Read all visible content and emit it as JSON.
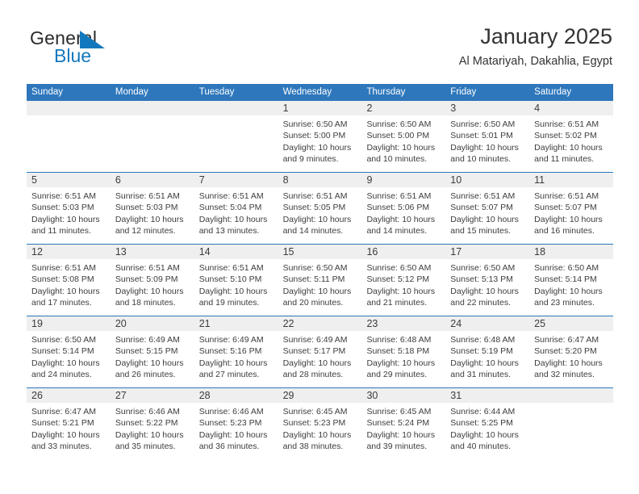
{
  "brand": {
    "name_part1": "General",
    "name_part2": "Blue",
    "accent_color": "#1278be",
    "flag_icon": "triangle-flag-icon"
  },
  "header": {
    "title": "January 2025",
    "subtitle": "Al Matariyah, Dakahlia, Egypt"
  },
  "calendar": {
    "header_color": "#2e77bc",
    "daynum_band_color": "#efefef",
    "weekdays": [
      "Sunday",
      "Monday",
      "Tuesday",
      "Wednesday",
      "Thursday",
      "Friday",
      "Saturday"
    ],
    "weeks": [
      [
        {
          "day": "",
          "lines": []
        },
        {
          "day": "",
          "lines": []
        },
        {
          "day": "",
          "lines": []
        },
        {
          "day": "1",
          "lines": [
            "Sunrise: 6:50 AM",
            "Sunset: 5:00 PM",
            "Daylight: 10 hours",
            "and 9 minutes."
          ]
        },
        {
          "day": "2",
          "lines": [
            "Sunrise: 6:50 AM",
            "Sunset: 5:00 PM",
            "Daylight: 10 hours",
            "and 10 minutes."
          ]
        },
        {
          "day": "3",
          "lines": [
            "Sunrise: 6:50 AM",
            "Sunset: 5:01 PM",
            "Daylight: 10 hours",
            "and 10 minutes."
          ]
        },
        {
          "day": "4",
          "lines": [
            "Sunrise: 6:51 AM",
            "Sunset: 5:02 PM",
            "Daylight: 10 hours",
            "and 11 minutes."
          ]
        }
      ],
      [
        {
          "day": "5",
          "lines": [
            "Sunrise: 6:51 AM",
            "Sunset: 5:03 PM",
            "Daylight: 10 hours",
            "and 11 minutes."
          ]
        },
        {
          "day": "6",
          "lines": [
            "Sunrise: 6:51 AM",
            "Sunset: 5:03 PM",
            "Daylight: 10 hours",
            "and 12 minutes."
          ]
        },
        {
          "day": "7",
          "lines": [
            "Sunrise: 6:51 AM",
            "Sunset: 5:04 PM",
            "Daylight: 10 hours",
            "and 13 minutes."
          ]
        },
        {
          "day": "8",
          "lines": [
            "Sunrise: 6:51 AM",
            "Sunset: 5:05 PM",
            "Daylight: 10 hours",
            "and 14 minutes."
          ]
        },
        {
          "day": "9",
          "lines": [
            "Sunrise: 6:51 AM",
            "Sunset: 5:06 PM",
            "Daylight: 10 hours",
            "and 14 minutes."
          ]
        },
        {
          "day": "10",
          "lines": [
            "Sunrise: 6:51 AM",
            "Sunset: 5:07 PM",
            "Daylight: 10 hours",
            "and 15 minutes."
          ]
        },
        {
          "day": "11",
          "lines": [
            "Sunrise: 6:51 AM",
            "Sunset: 5:07 PM",
            "Daylight: 10 hours",
            "and 16 minutes."
          ]
        }
      ],
      [
        {
          "day": "12",
          "lines": [
            "Sunrise: 6:51 AM",
            "Sunset: 5:08 PM",
            "Daylight: 10 hours",
            "and 17 minutes."
          ]
        },
        {
          "day": "13",
          "lines": [
            "Sunrise: 6:51 AM",
            "Sunset: 5:09 PM",
            "Daylight: 10 hours",
            "and 18 minutes."
          ]
        },
        {
          "day": "14",
          "lines": [
            "Sunrise: 6:51 AM",
            "Sunset: 5:10 PM",
            "Daylight: 10 hours",
            "and 19 minutes."
          ]
        },
        {
          "day": "15",
          "lines": [
            "Sunrise: 6:50 AM",
            "Sunset: 5:11 PM",
            "Daylight: 10 hours",
            "and 20 minutes."
          ]
        },
        {
          "day": "16",
          "lines": [
            "Sunrise: 6:50 AM",
            "Sunset: 5:12 PM",
            "Daylight: 10 hours",
            "and 21 minutes."
          ]
        },
        {
          "day": "17",
          "lines": [
            "Sunrise: 6:50 AM",
            "Sunset: 5:13 PM",
            "Daylight: 10 hours",
            "and 22 minutes."
          ]
        },
        {
          "day": "18",
          "lines": [
            "Sunrise: 6:50 AM",
            "Sunset: 5:14 PM",
            "Daylight: 10 hours",
            "and 23 minutes."
          ]
        }
      ],
      [
        {
          "day": "19",
          "lines": [
            "Sunrise: 6:50 AM",
            "Sunset: 5:14 PM",
            "Daylight: 10 hours",
            "and 24 minutes."
          ]
        },
        {
          "day": "20",
          "lines": [
            "Sunrise: 6:49 AM",
            "Sunset: 5:15 PM",
            "Daylight: 10 hours",
            "and 26 minutes."
          ]
        },
        {
          "day": "21",
          "lines": [
            "Sunrise: 6:49 AM",
            "Sunset: 5:16 PM",
            "Daylight: 10 hours",
            "and 27 minutes."
          ]
        },
        {
          "day": "22",
          "lines": [
            "Sunrise: 6:49 AM",
            "Sunset: 5:17 PM",
            "Daylight: 10 hours",
            "and 28 minutes."
          ]
        },
        {
          "day": "23",
          "lines": [
            "Sunrise: 6:48 AM",
            "Sunset: 5:18 PM",
            "Daylight: 10 hours",
            "and 29 minutes."
          ]
        },
        {
          "day": "24",
          "lines": [
            "Sunrise: 6:48 AM",
            "Sunset: 5:19 PM",
            "Daylight: 10 hours",
            "and 31 minutes."
          ]
        },
        {
          "day": "25",
          "lines": [
            "Sunrise: 6:47 AM",
            "Sunset: 5:20 PM",
            "Daylight: 10 hours",
            "and 32 minutes."
          ]
        }
      ],
      [
        {
          "day": "26",
          "lines": [
            "Sunrise: 6:47 AM",
            "Sunset: 5:21 PM",
            "Daylight: 10 hours",
            "and 33 minutes."
          ]
        },
        {
          "day": "27",
          "lines": [
            "Sunrise: 6:46 AM",
            "Sunset: 5:22 PM",
            "Daylight: 10 hours",
            "and 35 minutes."
          ]
        },
        {
          "day": "28",
          "lines": [
            "Sunrise: 6:46 AM",
            "Sunset: 5:23 PM",
            "Daylight: 10 hours",
            "and 36 minutes."
          ]
        },
        {
          "day": "29",
          "lines": [
            "Sunrise: 6:45 AM",
            "Sunset: 5:23 PM",
            "Daylight: 10 hours",
            "and 38 minutes."
          ]
        },
        {
          "day": "30",
          "lines": [
            "Sunrise: 6:45 AM",
            "Sunset: 5:24 PM",
            "Daylight: 10 hours",
            "and 39 minutes."
          ]
        },
        {
          "day": "31",
          "lines": [
            "Sunrise: 6:44 AM",
            "Sunset: 5:25 PM",
            "Daylight: 10 hours",
            "and 40 minutes."
          ]
        },
        {
          "day": "",
          "lines": []
        }
      ]
    ]
  }
}
